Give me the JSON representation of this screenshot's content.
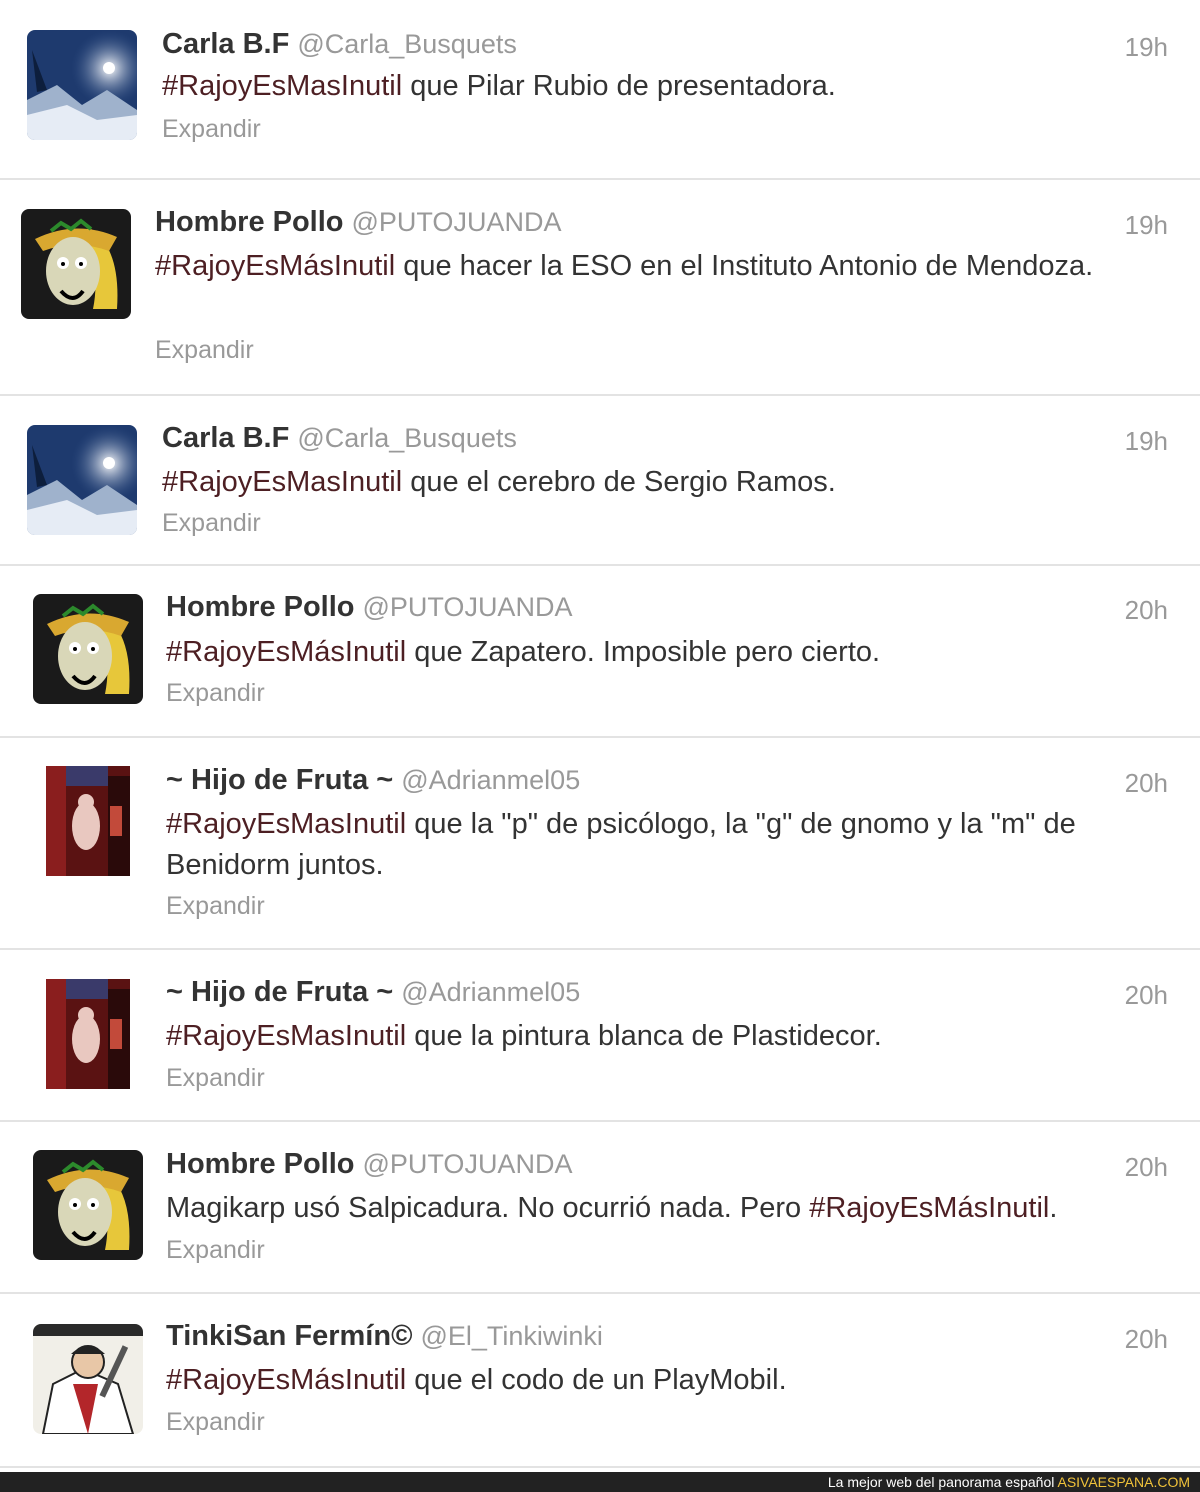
{
  "tweets": [
    {
      "name": "Carla B.F",
      "handle": "@Carla_Busquets",
      "time": "19h",
      "hashtag": "#RajoyEsMasInutil",
      "text_before": "",
      "text_after": " que Pilar Rubio de presentadora.",
      "expand": "Expandir",
      "avatar": "night-sky-icon"
    },
    {
      "name": "Hombre Pollo",
      "handle": "@PUTOJUANDA",
      "time": "19h",
      "hashtag": "#RajoyEsMásInutil",
      "text_before": "",
      "text_after": " que hacer la ESO en el Instituto Antonio de Mendoza.",
      "expand": "Expandir",
      "avatar": "cartoon-face-icon"
    },
    {
      "name": "Carla B.F",
      "handle": "@Carla_Busquets",
      "time": "19h",
      "hashtag": "#RajoyEsMasInutil",
      "text_before": "",
      "text_after": " que el cerebro de Sergio Ramos.",
      "expand": "Expandir",
      "avatar": "night-sky-icon"
    },
    {
      "name": "Hombre Pollo",
      "handle": "@PUTOJUANDA",
      "time": "20h",
      "hashtag": "#RajoyEsMásInutil",
      "text_before": "",
      "text_after": " que Zapatero. Imposible pero cierto.",
      "expand": "Expandir",
      "avatar": "cartoon-face-icon"
    },
    {
      "name": "~ Hijo de Fruta ~",
      "handle": "@Adrianmel05",
      "time": "20h",
      "hashtag": "#RajoyEsMasInutil",
      "text_before": "",
      "text_after": " que la \"p\" de psicólogo, la \"g\" de gnomo y la \"m\" de Benidorm juntos.",
      "expand": "Expandir",
      "avatar": "red-room-figure-icon"
    },
    {
      "name": "~ Hijo de Fruta ~",
      "handle": "@Adrianmel05",
      "time": "20h",
      "hashtag": "#RajoyEsMasInutil",
      "text_before": "",
      "text_after": " que la pintura blanca de Plastidecor.",
      "expand": "Expandir",
      "avatar": "red-room-figure-icon"
    },
    {
      "name": "Hombre Pollo",
      "handle": "@PUTOJUANDA",
      "time": "20h",
      "hashtag": "#RajoyEsMásInutil",
      "text_before": "Magikarp usó Salpicadura. No ocurrió nada. Pero ",
      "text_after": ".",
      "expand": "Expandir",
      "avatar": "cartoon-face-icon"
    },
    {
      "name": "TinkiSan Fermín©",
      "handle": "@El_Tinkiwinki",
      "time": "20h",
      "hashtag": "#RajoyEsMásInutil",
      "text_before": "",
      "text_after": " que el codo de un PlayMobil.",
      "expand": "Expandir",
      "avatar": "comic-character-icon"
    }
  ],
  "footer": {
    "tagline": "La mejor web del panorama español",
    "site": "ASIVAESPANA.COM"
  },
  "colors": {
    "hashtag": "#4d1f23",
    "meta": "#999999",
    "text": "#333333"
  }
}
